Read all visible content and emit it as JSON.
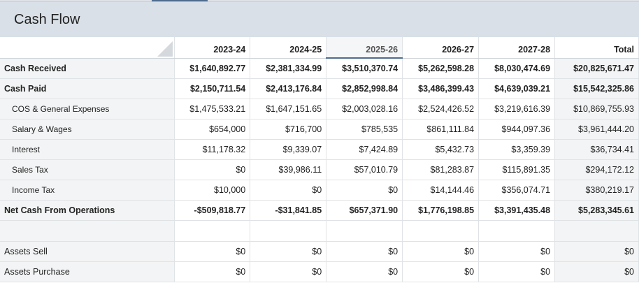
{
  "title": "Cash Flow",
  "columns": [
    "2023-24",
    "2024-25",
    "2025-26",
    "2026-27",
    "2027-28",
    "Total"
  ],
  "selected_column": "2025-26",
  "rows": [
    {
      "label": "Cash Received",
      "bold": true,
      "indent": false,
      "values": [
        "$1,640,892.77",
        "$2,381,334.99",
        "$3,510,370.74",
        "$5,262,598.28",
        "$8,030,474.69",
        "$20,825,671.47"
      ]
    },
    {
      "label": "Cash Paid",
      "bold": true,
      "indent": false,
      "values": [
        "$2,150,711.54",
        "$2,413,176.84",
        "$2,852,998.84",
        "$3,486,399.43",
        "$4,639,039.21",
        "$15,542,325.86"
      ]
    },
    {
      "label": "COS & General Expenses",
      "bold": false,
      "indent": true,
      "values": [
        "$1,475,533.21",
        "$1,647,151.65",
        "$2,003,028.16",
        "$2,524,426.52",
        "$3,219,616.39",
        "$10,869,755.93"
      ]
    },
    {
      "label": "Salary & Wages",
      "bold": false,
      "indent": true,
      "values": [
        "$654,000",
        "$716,700",
        "$785,535",
        "$861,111.84",
        "$944,097.36",
        "$3,961,444.20"
      ]
    },
    {
      "label": "Interest",
      "bold": false,
      "indent": true,
      "values": [
        "$11,178.32",
        "$9,339.07",
        "$7,424.89",
        "$5,432.73",
        "$3,359.39",
        "$36,734.41"
      ]
    },
    {
      "label": "Sales Tax",
      "bold": false,
      "indent": true,
      "values": [
        "$0",
        "$39,986.11",
        "$57,010.79",
        "$81,283.87",
        "$115,891.35",
        "$294,172.12"
      ]
    },
    {
      "label": "Income Tax",
      "bold": false,
      "indent": true,
      "values": [
        "$10,000",
        "$0",
        "$0",
        "$14,144.46",
        "$356,074.71",
        "$380,219.17"
      ]
    },
    {
      "label": "Net Cash From Operations",
      "bold": true,
      "indent": false,
      "values": [
        "-$509,818.77",
        "-$31,841.85",
        "$657,371.90",
        "$1,776,198.85",
        "$3,391,435.48",
        "$5,283,345.61"
      ]
    },
    {
      "label": "",
      "bold": false,
      "indent": false,
      "empty": true,
      "values": [
        "",
        "",
        "",
        "",
        "",
        ""
      ]
    },
    {
      "label": "Assets Sell",
      "bold": false,
      "indent": false,
      "values": [
        "$0",
        "$0",
        "$0",
        "$0",
        "$0",
        "$0"
      ]
    },
    {
      "label": "Assets Purchase",
      "bold": false,
      "indent": false,
      "values": [
        "$0",
        "$0",
        "$0",
        "$0",
        "$0",
        "$0"
      ]
    }
  ]
}
